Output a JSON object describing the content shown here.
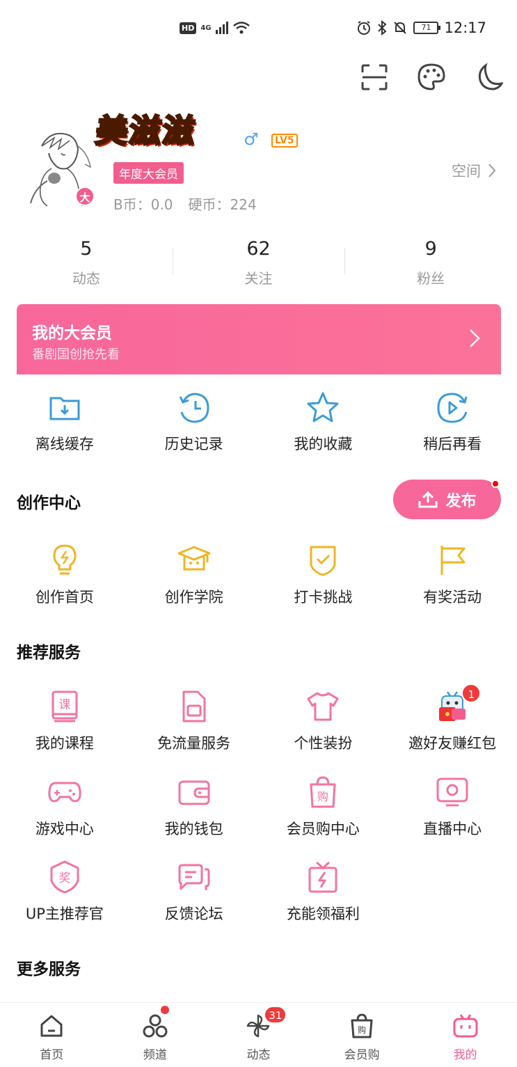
{
  "status_bar": {
    "hd": "HD",
    "network": "4G",
    "time": "12:17",
    "battery": "71"
  },
  "top_icons": [
    "scan-icon",
    "palette-icon",
    "moon-icon"
  ],
  "profile": {
    "username": "美滋滋",
    "gender": "♂",
    "level": "LV5",
    "vip_tag": "年度大会员",
    "avatar_badge": "大",
    "b_coin": "B币：0.0",
    "hard_coin": "硬币：224",
    "space_label": "空间"
  },
  "stats": [
    {
      "num": "5",
      "label": "动态"
    },
    {
      "num": "62",
      "label": "关注"
    },
    {
      "num": "9",
      "label": "粉丝"
    }
  ],
  "vip_banner": {
    "title": "我的大会员",
    "subtitle": "番剧国创抢先看"
  },
  "quick": [
    {
      "label": "离线缓存",
      "icon": "download-folder-icon"
    },
    {
      "label": "历史记录",
      "icon": "history-icon"
    },
    {
      "label": "我的收藏",
      "icon": "star-icon"
    },
    {
      "label": "稍后再看",
      "icon": "watch-later-icon"
    }
  ],
  "creation": {
    "title": "创作中心",
    "publish_label": "发布",
    "items": [
      {
        "label": "创作首页",
        "icon": "lightbulb-icon"
      },
      {
        "label": "创作学院",
        "icon": "graduation-cap-icon"
      },
      {
        "label": "打卡挑战",
        "icon": "check-shield-icon"
      },
      {
        "label": "有奖活动",
        "icon": "flag-icon"
      }
    ]
  },
  "recommended": {
    "title": "推荐服务",
    "row1": [
      {
        "label": "我的课程",
        "icon": "course-book-icon",
        "glyph": "课"
      },
      {
        "label": "免流量服务",
        "icon": "sim-card-icon"
      },
      {
        "label": "个性装扮",
        "icon": "tshirt-icon"
      },
      {
        "label": "邀好友赚红包",
        "icon": "tv-mascot-red-packet-icon",
        "badge": "1"
      }
    ],
    "row2": [
      {
        "label": "游戏中心",
        "icon": "gamepad-icon"
      },
      {
        "label": "我的钱包",
        "icon": "wallet-icon"
      },
      {
        "label": "会员购中心",
        "icon": "shopping-bag-icon",
        "glyph": "购"
      },
      {
        "label": "直播中心",
        "icon": "live-tv-icon"
      }
    ],
    "row3": [
      {
        "label": "UP主推荐官",
        "icon": "award-badge-icon",
        "glyph": "奖"
      },
      {
        "label": "反馈论坛",
        "icon": "chat-bubbles-icon"
      },
      {
        "label": "充能领福利",
        "icon": "gift-bolt-icon"
      }
    ]
  },
  "more": {
    "title": "更多服务"
  },
  "bottom_nav": [
    {
      "label": "首页",
      "icon": "home-icon"
    },
    {
      "label": "频道",
      "icon": "channel-icon",
      "dot": true
    },
    {
      "label": "动态",
      "icon": "pinwheel-icon",
      "count": "31"
    },
    {
      "label": "会员购",
      "icon": "shop-bag-icon",
      "glyph": "购"
    },
    {
      "label": "我的",
      "icon": "tv-mine-icon",
      "active": true
    }
  ],
  "colors": {
    "accent": "#f25d8e",
    "blue_icon": "#3a9bd8",
    "yellow_icon": "#f0b520",
    "pink_icon": "#f2749c"
  }
}
